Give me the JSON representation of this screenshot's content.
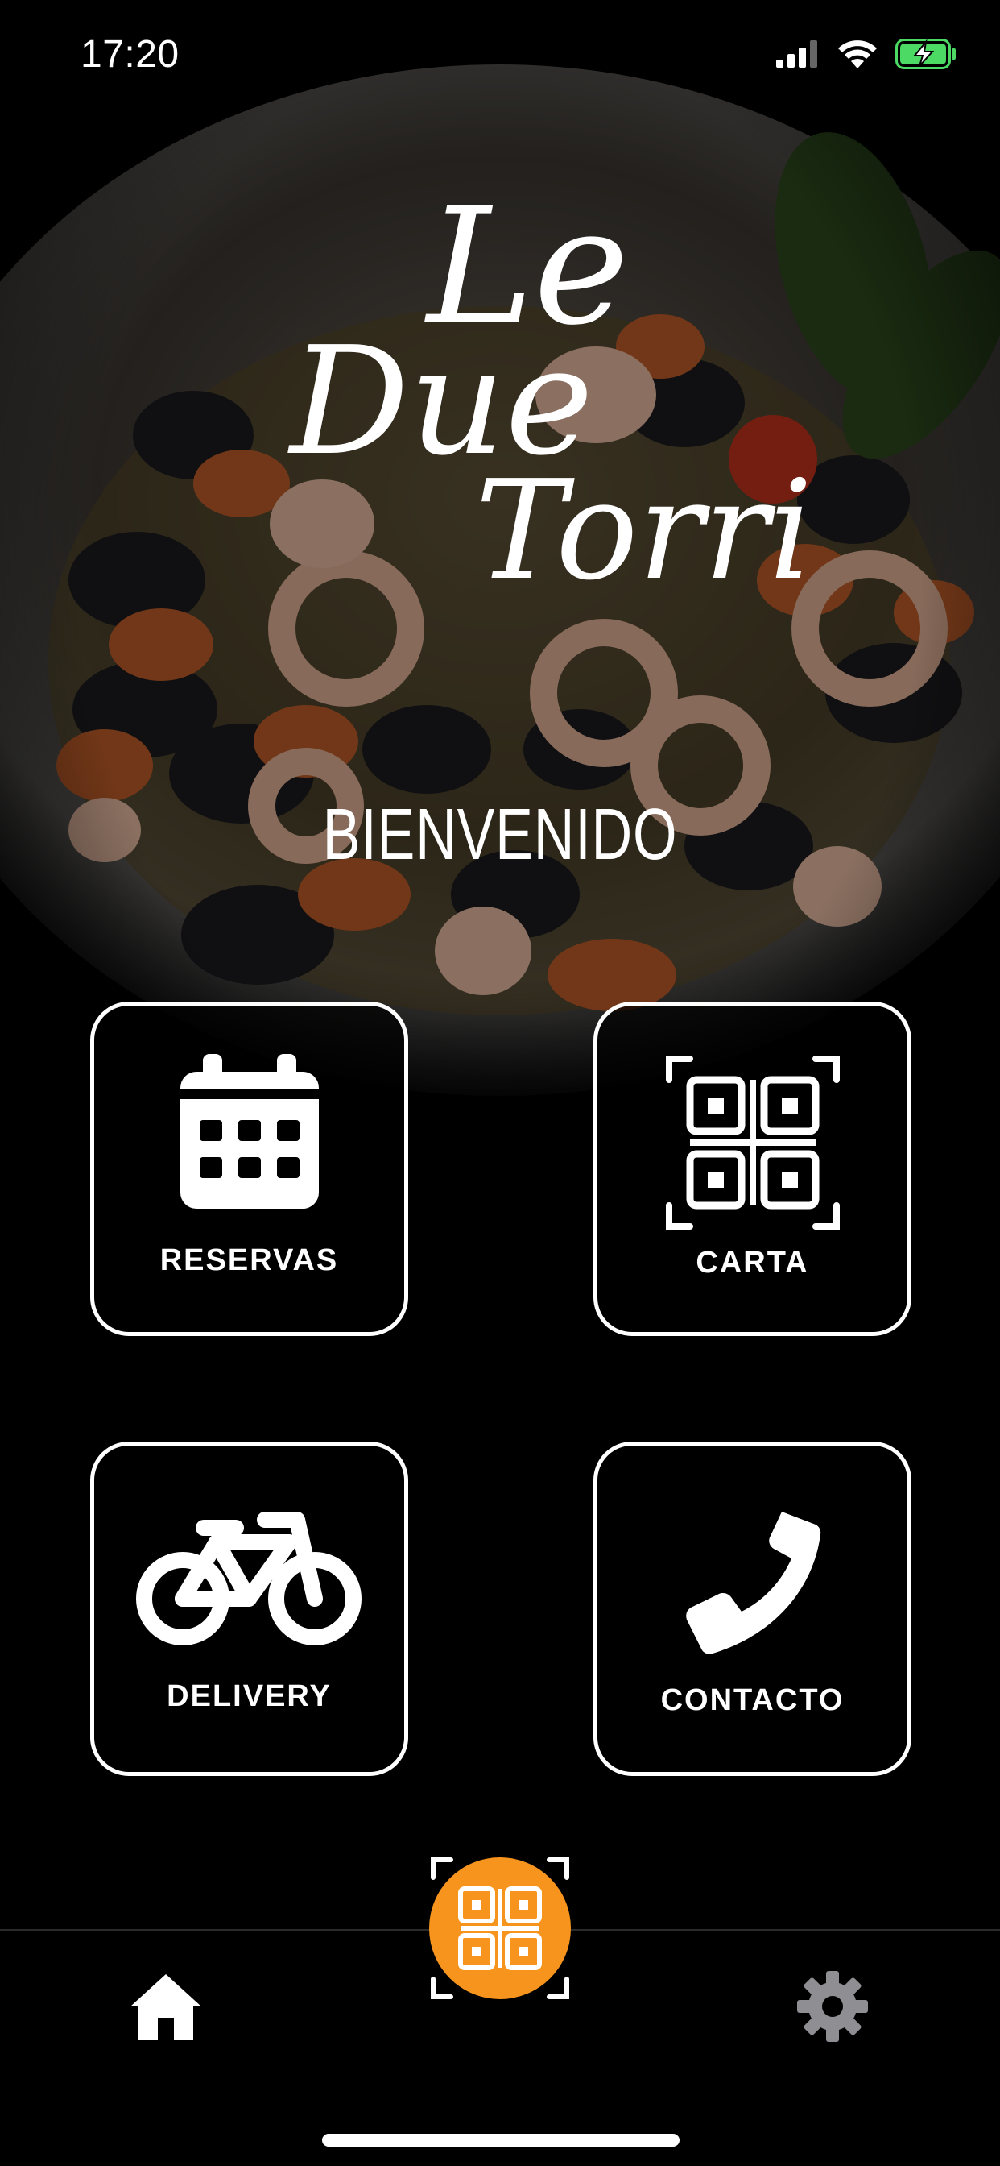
{
  "status_bar": {
    "time": "17:20",
    "icons": [
      "signal-icon",
      "wifi-icon",
      "battery-charging-icon"
    ],
    "battery_color": "#4cd964"
  },
  "logo": {
    "line1": "Le",
    "line2": "Due",
    "line3": "Torri"
  },
  "welcome": "BIENVENIDO",
  "tiles": [
    {
      "id": "reservas",
      "label": "RESERVAS",
      "icon": "calendar-icon"
    },
    {
      "id": "carta",
      "label": "CARTA",
      "icon": "qr-code-icon"
    },
    {
      "id": "delivery",
      "label": "DELIVERY",
      "icon": "bicycle-icon"
    },
    {
      "id": "contacto",
      "label": "CONTACTO",
      "icon": "phone-icon"
    }
  ],
  "tab_bar": {
    "items": [
      {
        "id": "home",
        "icon": "home-icon",
        "color": "#ffffff"
      },
      {
        "id": "qr",
        "icon": "qr-code-icon",
        "color": "#f7941d"
      },
      {
        "id": "settings",
        "icon": "gear-icon",
        "color": "#8e8e93"
      }
    ]
  },
  "colors": {
    "background": "#000000",
    "accent": "#f7941d",
    "text": "#ffffff"
  }
}
